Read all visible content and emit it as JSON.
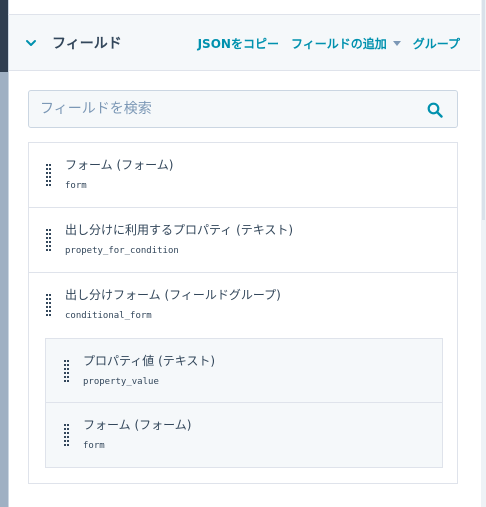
{
  "header": {
    "title": "フィールド",
    "copy_json": "JSONをコピー",
    "add_field": "フィールドの追加",
    "group": "グループ"
  },
  "search": {
    "placeholder": "フィールドを検索"
  },
  "fields": [
    {
      "label": "フォーム (フォーム)",
      "name": "form"
    },
    {
      "label": "出し分けに利用するプロパティ (テキスト)",
      "name": "propety_for_condition"
    },
    {
      "label": "出し分けフォーム (フィールドグループ)",
      "name": "conditional_form",
      "children": [
        {
          "label": "プロパティ値 (テキスト)",
          "name": "property_value"
        },
        {
          "label": "フォーム (フォーム)",
          "name": "form"
        }
      ]
    }
  ]
}
